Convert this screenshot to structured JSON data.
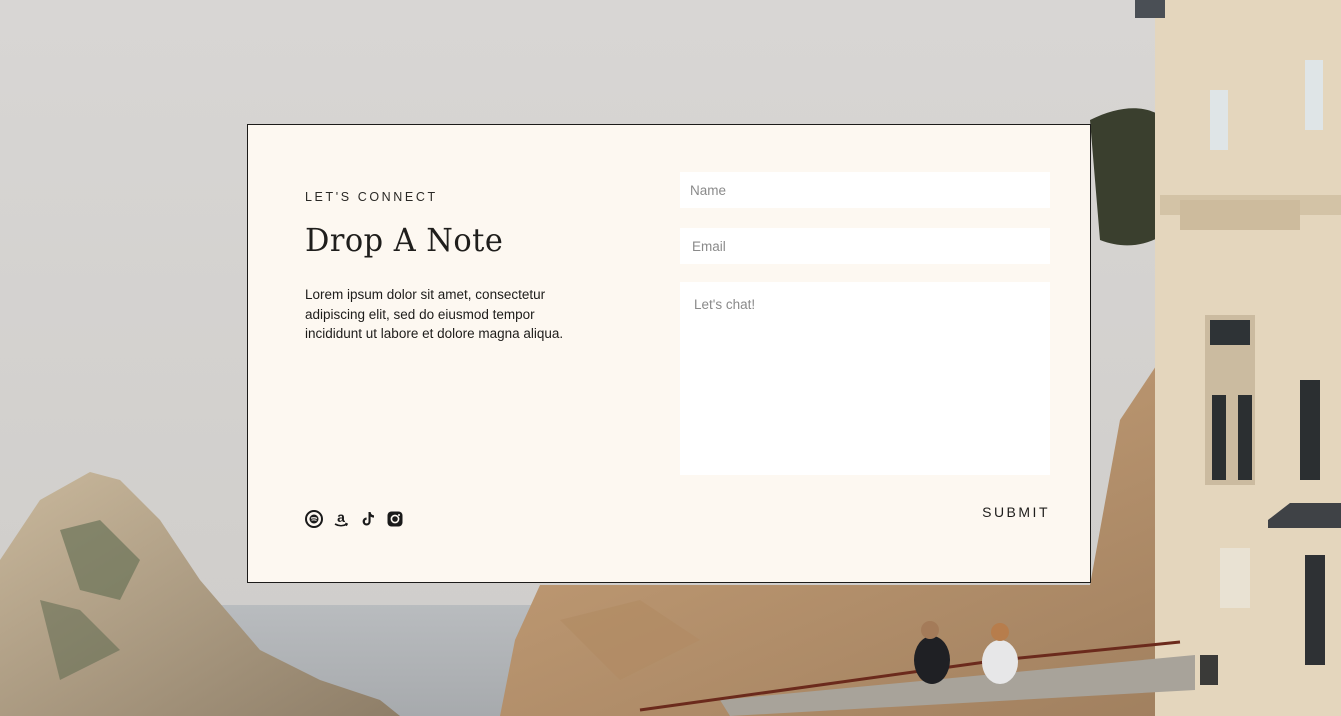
{
  "contact": {
    "eyebrow": "LET'S CONNECT",
    "title": "Drop A Note",
    "body": "Lorem ipsum dolor sit amet, consectetur adipiscing elit, sed do eiusmod tempor incididunt ut labore et dolore magna aliqua."
  },
  "form": {
    "name_placeholder": "Name",
    "email_placeholder": "Email",
    "message_placeholder": "Let's chat!",
    "submit_label": "SUBMIT"
  },
  "socials": [
    "spotify-icon",
    "amazon-icon",
    "tiktok-icon",
    "instagram-icon"
  ],
  "colors": {
    "card_background": "#fdf8f1",
    "card_border": "#1c1b19",
    "text": "#1f1e1c",
    "field_background": "#ffffff",
    "placeholder": "#8a8a8a"
  }
}
